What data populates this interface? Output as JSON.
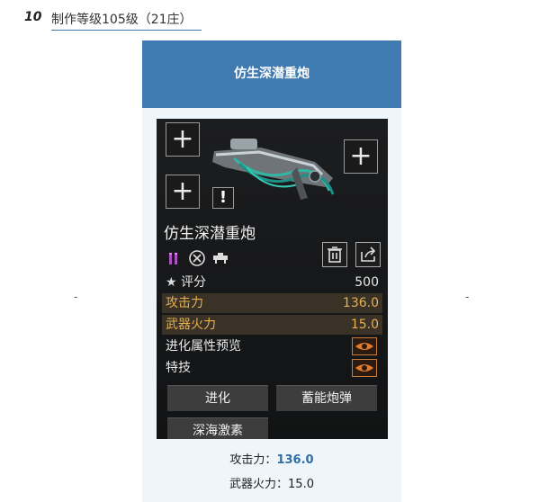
{
  "section": {
    "number": "10",
    "title": "制作等级105级（21庄）"
  },
  "side_marks": {
    "left": "-",
    "right": "-"
  },
  "panel": {
    "title": "仿生深潜重炮"
  },
  "card": {
    "plus": "+",
    "warn": "!",
    "weapon_name": "仿生深潜重炮",
    "stats": [
      {
        "label": "评分",
        "value": "500"
      },
      {
        "label": "攻击力",
        "value": "136.0"
      },
      {
        "label": "武器火力",
        "value": "15.0"
      }
    ],
    "evolution_preview": "进化属性预览",
    "skill": "特技",
    "buttons": {
      "evolve": "进化",
      "charge": "蓄能炮弹",
      "abyss": "深海激素"
    },
    "colors": {
      "highlight": "#e6b152",
      "eye": "#e07b2d"
    }
  },
  "caption": {
    "attack_label": "攻击力：",
    "attack_value": "136.0",
    "firepower_label": "武器火力：",
    "firepower_value": "15.0"
  }
}
